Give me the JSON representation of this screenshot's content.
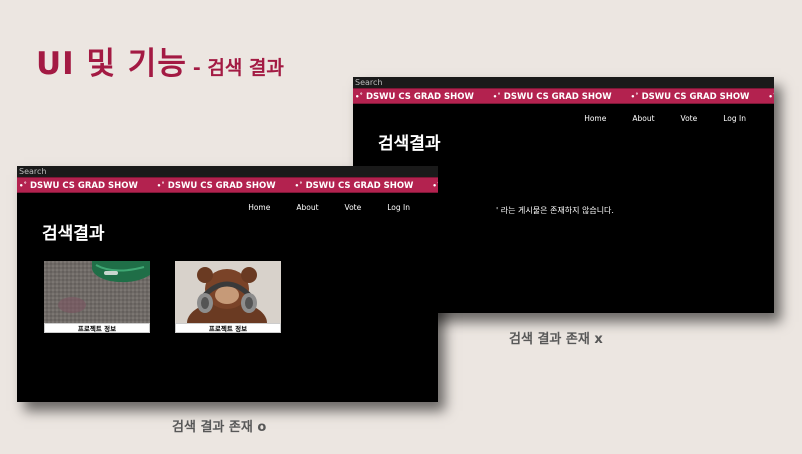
{
  "slide": {
    "title": "UI 및 기능",
    "subtitle": "- 검색 결과"
  },
  "site": {
    "search_label": "Search",
    "ticker_text": "DSWU CS GRAD SHOW",
    "nav": [
      "Home",
      "About",
      "Vote",
      "Log In"
    ],
    "results_heading": "검색결과"
  },
  "no_result_screen": {
    "message": "' 라는 게시물은 존재하지 않습니다.",
    "caption": "검색 결과 존재 x"
  },
  "result_screen": {
    "cards": [
      {
        "label": "프로젝트 정보",
        "image": "ipad-on-carpet"
      },
      {
        "label": "프로젝트 정보",
        "image": "plush-monkey-with-headphones"
      }
    ],
    "caption": "검색 결과 존재 o"
  },
  "colors": {
    "accent": "#a31a43",
    "ticker": "#b3224f",
    "screen_bg": "#000000",
    "slide_bg": "#ece6e1"
  }
}
